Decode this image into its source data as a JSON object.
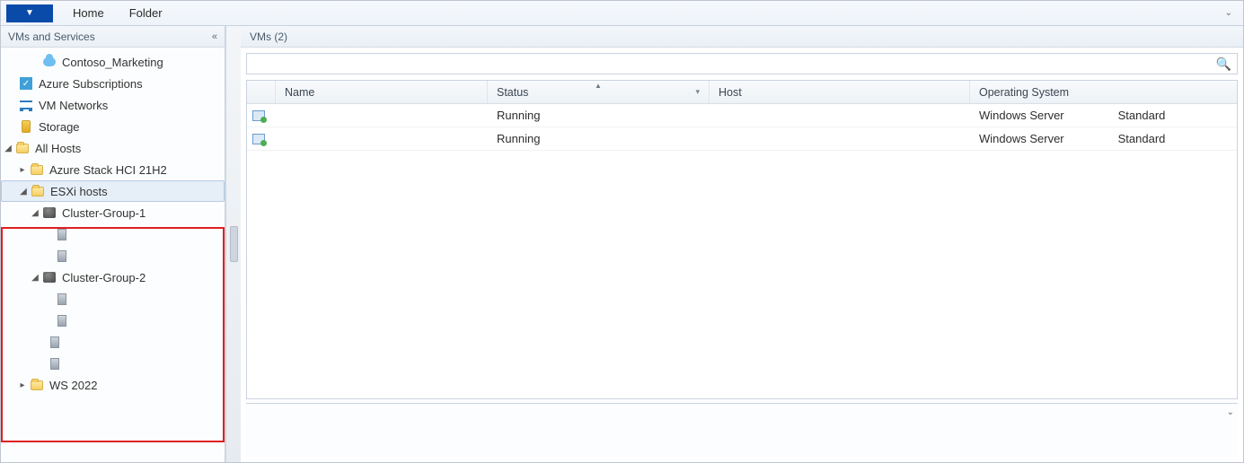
{
  "ribbon": {
    "tabs": [
      "Home",
      "Folder"
    ]
  },
  "sidebar": {
    "title": "VMs and Services",
    "items": {
      "contoso_marketing": "Contoso_Marketing",
      "azure_subs": "Azure Subscriptions",
      "vm_networks": "VM Networks",
      "storage": "Storage",
      "all_hosts": "All Hosts",
      "azure_stack": "Azure Stack HCI 21H2",
      "esxi": "ESXi hosts",
      "cg1": "Cluster-Group-1",
      "cg2": "Cluster-Group-2",
      "ws2022": "WS 2022"
    }
  },
  "content": {
    "header": "VMs (2)",
    "search_placeholder": "",
    "columns": {
      "name": "Name",
      "status": "Status",
      "host": "Host",
      "os": "Operating System"
    },
    "rows": [
      {
        "name": "",
        "status": "Running",
        "host": "",
        "os": "Windows Server",
        "os2": "Standard"
      },
      {
        "name": "",
        "status": "Running",
        "host": "",
        "os": "Windows Server",
        "os2": "Standard"
      }
    ]
  }
}
